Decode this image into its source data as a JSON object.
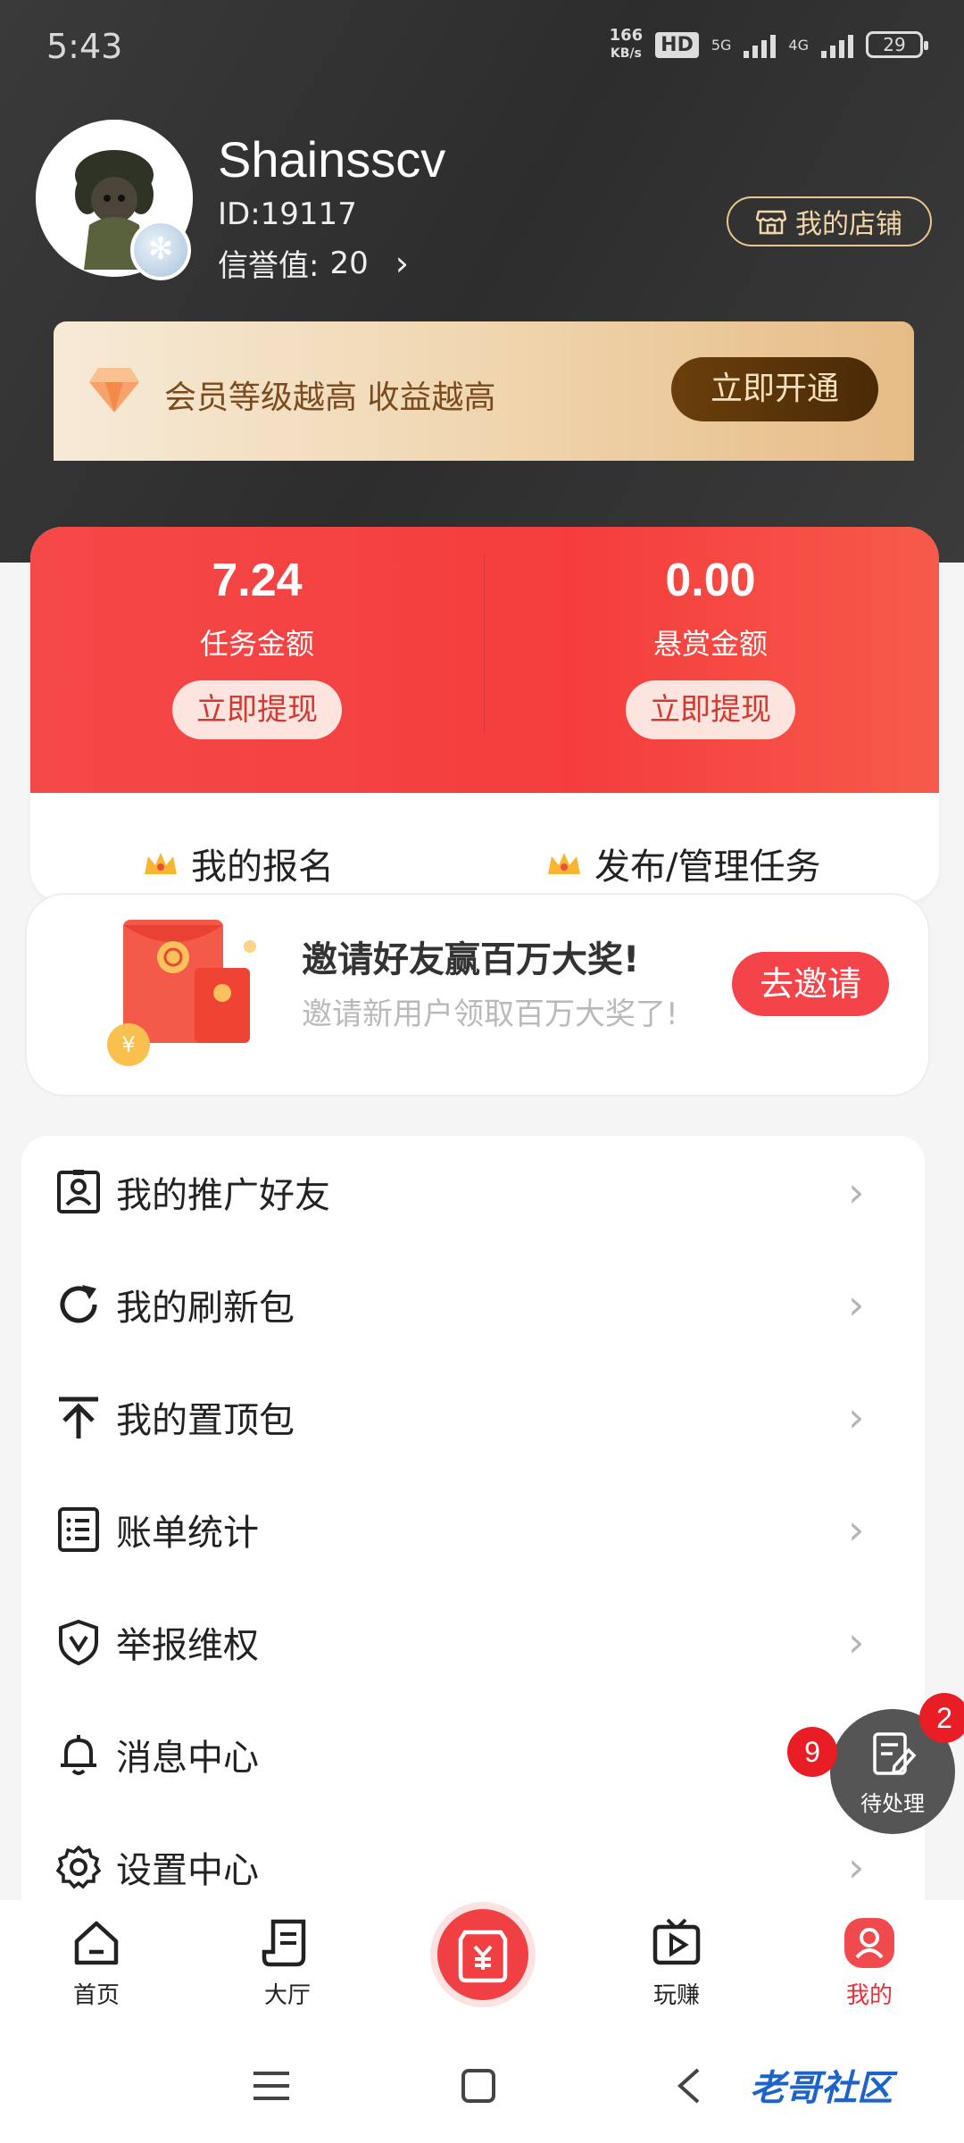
{
  "status_bar": {
    "time": "5:43",
    "net_speed_value": "166",
    "net_speed_unit": "KB/s",
    "hd": "HD",
    "sig1": "5G",
    "sig2": "4G",
    "battery": "29"
  },
  "profile": {
    "username": "Shainsscv",
    "id": "ID:19117",
    "credit_label": "信誉值:",
    "credit_value": "20",
    "shop_button": "我的店铺"
  },
  "vip": {
    "text": "会员等级越高 收益越高",
    "button": "立即开通"
  },
  "wallet": {
    "task_amount": "7.24",
    "task_label": "任务金额",
    "task_withdraw": "立即提现",
    "bounty_amount": "0.00",
    "bounty_label": "悬赏金额",
    "bounty_withdraw": "立即提现",
    "my_signup": "我的报名",
    "publish_manage": "发布/管理任务"
  },
  "invite": {
    "title": "邀请好友赢百万大奖!",
    "subtitle": "邀请新用户领取百万大奖了!",
    "button": "去邀请"
  },
  "menu": {
    "items": [
      {
        "label": "我的推广好友",
        "icon": "contact-icon"
      },
      {
        "label": "我的刷新包",
        "icon": "refresh-icon"
      },
      {
        "label": "我的置顶包",
        "icon": "pin-top-icon"
      },
      {
        "label": "账单统计",
        "icon": "bill-icon"
      },
      {
        "label": "举报维权",
        "icon": "shield-icon"
      },
      {
        "label": "消息中心",
        "icon": "bell-icon"
      },
      {
        "label": "设置中心",
        "icon": "gear-icon"
      }
    ]
  },
  "floating": {
    "label": "待处理",
    "badge_pending": "2",
    "badge_messages": "9"
  },
  "bottom_nav": {
    "home": "首页",
    "hall": "大厅",
    "earn": "玩赚",
    "mine": "我的"
  },
  "watermark": "老哥社区"
}
